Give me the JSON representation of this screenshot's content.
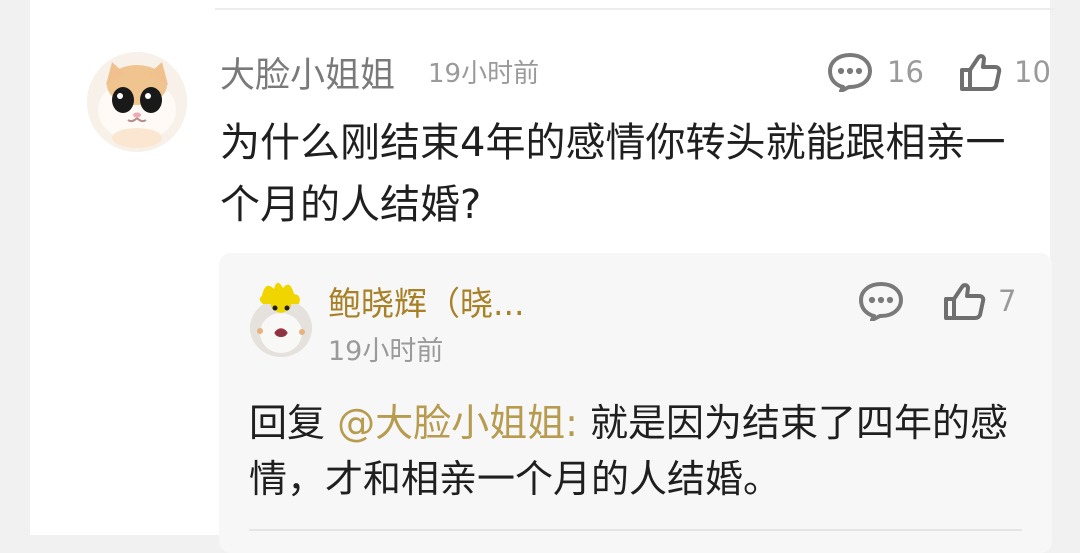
{
  "comment": {
    "author": "大脸小姐姐",
    "time": "19小时前",
    "reply_count": "16",
    "like_count": "10",
    "text": "为什么刚结束4年的感情你转头就能跟相亲一个月的人结婚?",
    "avatar_icon": "cat-avatar"
  },
  "reply": {
    "author": "鲍晓辉（晓...",
    "time": "19小时前",
    "like_count": "7",
    "prefix": "回复",
    "mention": "@大脸小姐姐:",
    "body": "就是因为结束了四年的感情，才和相亲一个月的人结婚。",
    "avatar_icon": "bird-avatar"
  },
  "icons": {
    "comment": "speech-bubble-icon",
    "like": "thumbs-up-icon"
  },
  "colors": {
    "author": "#7a7a7a",
    "meta": "#9a9a9a",
    "reply_author": "#a88127",
    "mention": "#b79b4f"
  }
}
